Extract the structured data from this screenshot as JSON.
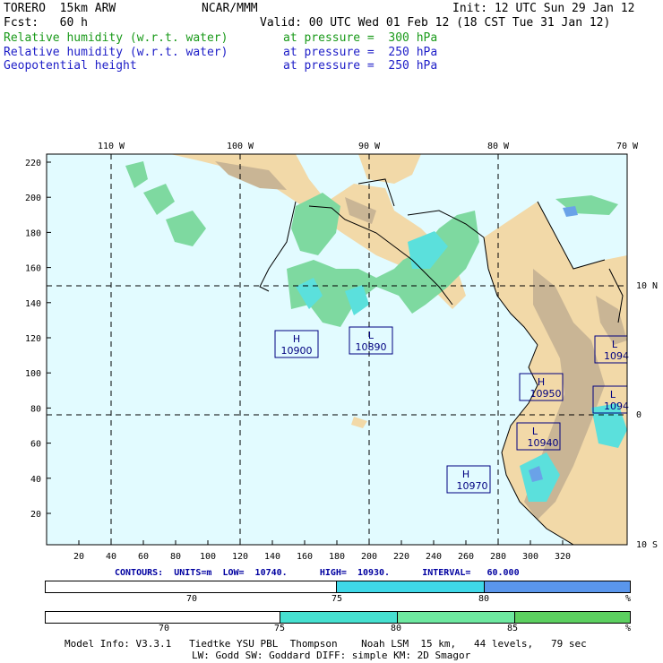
{
  "header": {
    "model": "TORERO  15km ARW",
    "org": "NCAR/MMM",
    "init": "Init: 12 UTC Sun 29 Jan 12",
    "fcst": "Fcst:   60 h",
    "valid": "Valid: 00 UTC Wed 01 Feb 12 (18 CST Tue 31 Jan 12)",
    "fields": [
      {
        "name": "Relative humidity (w.r.t. water)",
        "level": "at pressure =  300 hPa",
        "color": "#1a9a1a"
      },
      {
        "name": "Relative humidity (w.r.t. water)",
        "level": "at pressure =  250 hPa",
        "color": "#2020c8"
      },
      {
        "name": "Geopotential height",
        "level": "at pressure =  250 hPa",
        "color": "#2020c8"
      }
    ]
  },
  "map": {
    "lon_labels": [
      "110 W",
      "100 W",
      "90 W",
      "80 W",
      "70 W"
    ],
    "lat_labels_right": [
      "10 N",
      "0",
      "10 S"
    ],
    "y_ticks": [
      "220",
      "200",
      "180",
      "160",
      "140",
      "120",
      "100",
      "80",
      "60",
      "40",
      "20"
    ],
    "x_ticks": [
      "20",
      "40",
      "60",
      "80",
      "100",
      "120",
      "140",
      "160",
      "180",
      "200",
      "220",
      "240",
      "260",
      "280",
      "300",
      "320"
    ],
    "highs_lows": [
      {
        "type": "H",
        "value": "10900"
      },
      {
        "type": "L",
        "value": "10890"
      },
      {
        "type": "H",
        "value": "10950"
      },
      {
        "type": "L",
        "value": "10940"
      },
      {
        "type": "H",
        "value": "10970"
      },
      {
        "type": "L",
        "value": "1094"
      },
      {
        "type": "L",
        "value": "1094"
      }
    ],
    "colors": {
      "ocean": "#e2fbff",
      "land": "#f2d9a8",
      "mountain": "#c9b595",
      "rh_green": "#7ed9a0",
      "rh_cyan": "#5be0dc",
      "rh_blue": "#6aa2e8"
    }
  },
  "contours": {
    "label": "CONTOURS:",
    "units": "UNITS=m",
    "low": "LOW=  10740.",
    "high": "HIGH=  10930.",
    "interval": "INTERVAL=   60.000"
  },
  "bar1": {
    "labels": [
      "70",
      "75",
      "80",
      "%"
    ],
    "colors": [
      "#ffffff",
      "#3fd8e8",
      "#5a96ec"
    ]
  },
  "bar2": {
    "labels": [
      "70",
      "75",
      "80",
      "85",
      "%"
    ],
    "colors": [
      "#ffffff",
      "#46e0d0",
      "#6ee8a0",
      "#5cd060"
    ]
  },
  "footer": {
    "line1": "Model Info: V3.3.1   Tiedtke YSU PBL  Thompson    Noah LSM  15 km,   44 levels,   79 sec",
    "line2": "LW: Godd SW: Goddard DIFF: simple KM: 2D Smagor"
  }
}
